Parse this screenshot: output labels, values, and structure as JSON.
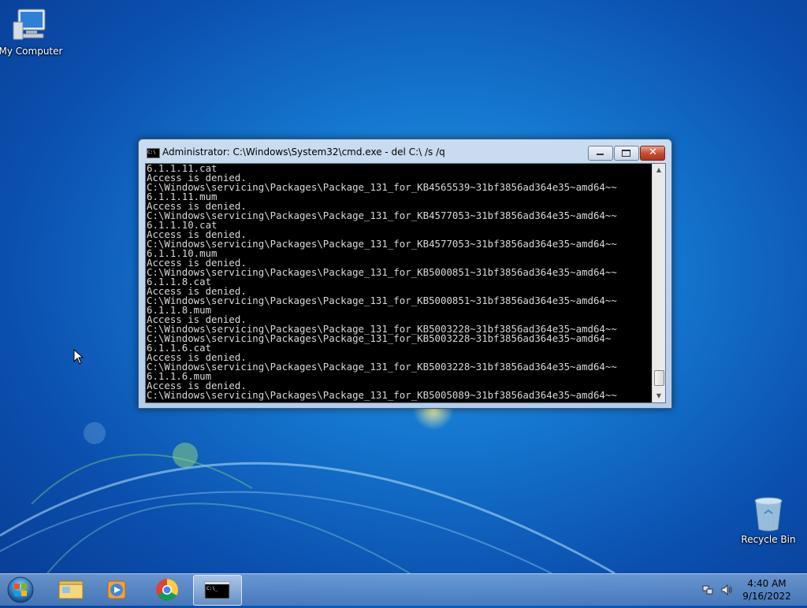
{
  "desktop": {
    "icons": [
      {
        "label": "My Computer",
        "icon": "computer-icon"
      },
      {
        "label": "Recycle Bin",
        "icon": "recycle-bin-icon"
      }
    ]
  },
  "cmd_window": {
    "title": "Administrator: C:\\Windows\\System32\\cmd.exe - del  C:\\ /s /q",
    "icon": "cmd-icon",
    "lines": [
      "6.1.1.11.cat",
      "Access is denied.",
      "C:\\Windows\\servicing\\Packages\\Package_131_for_KB4565539~31bf3856ad364e35~amd64~~",
      "6.1.1.11.mum",
      "Access is denied.",
      "C:\\Windows\\servicing\\Packages\\Package_131_for_KB4577053~31bf3856ad364e35~amd64~~",
      "6.1.1.10.cat",
      "Access is denied.",
      "C:\\Windows\\servicing\\Packages\\Package_131_for_KB4577053~31bf3856ad364e35~amd64~~",
      "6.1.1.10.mum",
      "Access is denied.",
      "C:\\Windows\\servicing\\Packages\\Package_131_for_KB5000851~31bf3856ad364e35~amd64~~",
      "6.1.1.8.cat",
      "Access is denied.",
      "C:\\Windows\\servicing\\Packages\\Package_131_for_KB5000851~31bf3856ad364e35~amd64~~",
      "6.1.1.8.mum",
      "Access is denied.",
      "C:\\Windows\\servicing\\Packages\\Package_131_for_KB5003228~31bf3856ad364e35~amd64~~",
      "C:\\Windows\\servicing\\Packages\\Package_131_for_KB5003228~31bf3856ad364e35~amd64~",
      "6.1.1.6.cat",
      "Access is denied.",
      "C:\\Windows\\servicing\\Packages\\Package_131_for_KB5003228~31bf3856ad364e35~amd64~~",
      "6.1.1.6.mum",
      "Access is denied.",
      "C:\\Windows\\servicing\\Packages\\Package_131_for_KB5005089~31bf3856ad364e35~amd64~~"
    ]
  },
  "taskbar": {
    "items": [
      {
        "name": "start-button",
        "icon": "windows-logo-icon"
      },
      {
        "name": "explorer",
        "icon": "folder-icon"
      },
      {
        "name": "media-player",
        "icon": "media-player-icon"
      },
      {
        "name": "chrome",
        "icon": "chrome-icon"
      },
      {
        "name": "cmd",
        "icon": "cmd-icon",
        "active": true
      }
    ],
    "tray": {
      "icons": [
        "network-icon",
        "volume-icon"
      ],
      "time": "4:40 AM",
      "date": "9/16/2022"
    }
  }
}
